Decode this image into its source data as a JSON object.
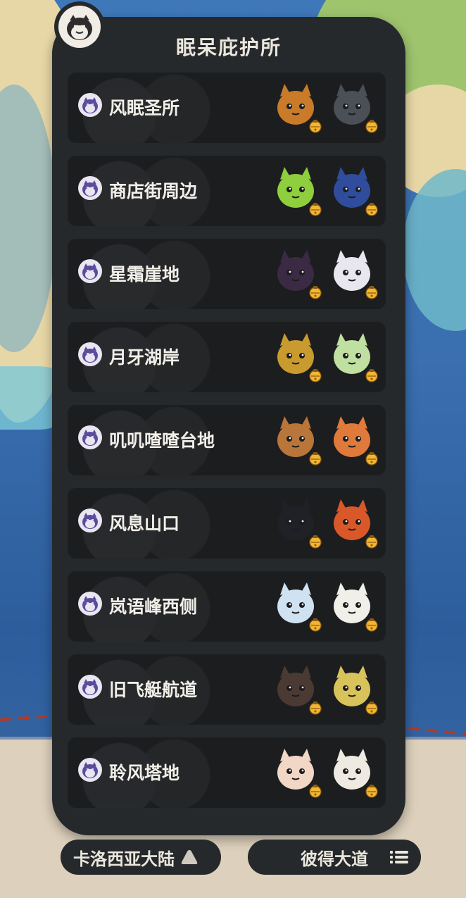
{
  "panel": {
    "title": "眠呆庇护所",
    "locations": [
      {
        "label": "风眠圣所",
        "pokemon": [
          "orange-rock-pokemon",
          "dark-fox-pokemon"
        ]
      },
      {
        "label": "商店街周边",
        "pokemon": [
          "green-cat-pokemon",
          "blue-bird-pokemon"
        ]
      },
      {
        "label": "星霜崖地",
        "pokemon": [
          "dark-ghost-pokemon",
          "white-fluffy-pokemon"
        ]
      },
      {
        "label": "月牙湖岸",
        "pokemon": [
          "gold-treasure-pokemon",
          "green-bird-pokemon"
        ]
      },
      {
        "label": "叽叽喳喳台地",
        "pokemon": [
          "brown-monkey-pokemon",
          "orange-robot-pokemon"
        ]
      },
      {
        "label": "风息山口",
        "pokemon": [
          "black-cat-pokemon",
          "orange-flame-pokemon"
        ]
      },
      {
        "label": "岚语峰西侧",
        "pokemon": [
          "white-dragon-pokemon",
          "white-bulb-pokemon"
        ]
      },
      {
        "label": "旧飞艇航道",
        "pokemon": [
          "dark-ball-pokemon",
          "yellow-bird-pokemon"
        ]
      },
      {
        "label": "聆风塔地",
        "pokemon": [
          "fluffy-rabbit-pokemon",
          "white-skull-pokemon"
        ]
      }
    ]
  },
  "bottom_bar": {
    "region_label": "卡洛西亚大陆",
    "route_label": "彼得大道"
  },
  "colors": {
    "panel_bg": "#25292c",
    "card_bg": "#1c1d1e",
    "text": "#f2efe9",
    "bell": "#f2b632"
  }
}
